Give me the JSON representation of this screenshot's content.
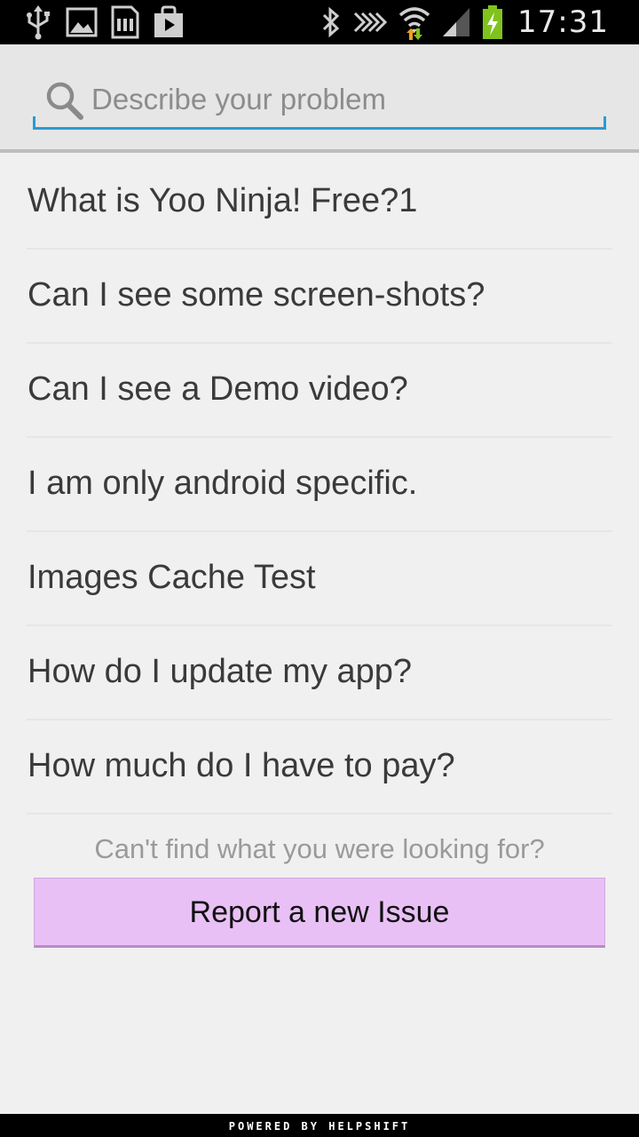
{
  "status_bar": {
    "left_icons": [
      "usb-icon",
      "image-icon",
      "sd-card-icon",
      "play-store-icon"
    ],
    "right_icons": [
      "bluetooth-icon",
      "nfc-icon",
      "wifi-icon",
      "cell-signal-icon",
      "battery-charging-icon"
    ],
    "time": "17:31",
    "battery_color": "#7fc31c"
  },
  "search": {
    "placeholder": "Describe your problem",
    "value": "",
    "accent_color": "#2a9bd3"
  },
  "faq": {
    "items": [
      {
        "label": "What is Yoo Ninja! Free?1"
      },
      {
        "label": "Can I see some screen-shots?"
      },
      {
        "label": "Can I see a Demo video?"
      },
      {
        "label": "I am only android specific."
      },
      {
        "label": "Images Cache Test"
      },
      {
        "label": "How do I update my app?"
      },
      {
        "label": "How much do I have to pay?"
      }
    ]
  },
  "help": {
    "prompt": "Can't find what you were looking for?",
    "report_button": "Report a new Issue",
    "button_color": "#e8c0f5"
  },
  "footer": {
    "text": "POWERED BY HELPSHIFT"
  }
}
